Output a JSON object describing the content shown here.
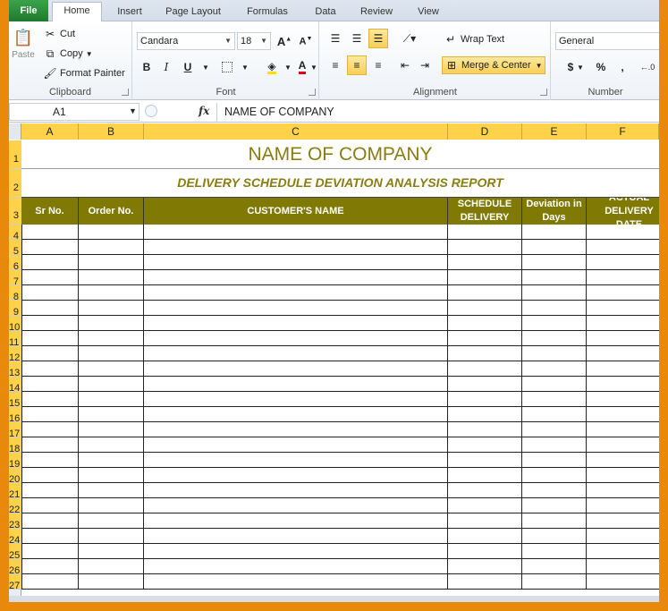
{
  "ribbon": {
    "tabs": [
      "File",
      "Home",
      "Insert",
      "Page Layout",
      "Formulas",
      "Data",
      "Review",
      "View"
    ],
    "active_tab": "Home",
    "clipboard": {
      "label": "Clipboard",
      "paste": "Paste",
      "cut": "Cut",
      "copy": "Copy",
      "format_painter": "Format Painter"
    },
    "font": {
      "label": "Font",
      "name": "Candara",
      "size": "18",
      "bold": "B",
      "italic": "I",
      "underline": "U",
      "font_color_glyph": "A"
    },
    "alignment": {
      "label": "Alignment",
      "wrap_text": "Wrap Text",
      "merge_center": "Merge & Center"
    },
    "number": {
      "label": "Number",
      "format": "General",
      "currency": "$",
      "percent": "%",
      "comma": ","
    }
  },
  "formula_bar": {
    "name_box": "A1",
    "fx": "fx",
    "content": "NAME OF COMPANY"
  },
  "grid": {
    "columns": [
      "A",
      "B",
      "C",
      "D",
      "E",
      "F"
    ],
    "rows": [
      "1",
      "2",
      "3",
      "4",
      "5",
      "6",
      "7",
      "8",
      "9",
      "10",
      "11",
      "12",
      "13",
      "14",
      "15",
      "16",
      "17",
      "18",
      "19",
      "20",
      "21",
      "22",
      "23",
      "24",
      "25",
      "26",
      "27"
    ]
  },
  "sheet": {
    "title": "NAME OF COMPANY",
    "subtitle": "DELIVERY SCHEDULE DEVIATION ANALYSIS REPORT",
    "headers": [
      "Sr No.",
      "Order No.",
      "CUSTOMER'S NAME",
      "SCHEDULE DELIVERY",
      "Deviation in Days",
      "ACTUAL DELIVERY DATE"
    ],
    "empty_rows": 24
  },
  "colors": {
    "header_bg": "#807a05",
    "title_text": "#8a7d12",
    "accent_yellow": "#ffd24a",
    "frame": "#e8890c"
  }
}
